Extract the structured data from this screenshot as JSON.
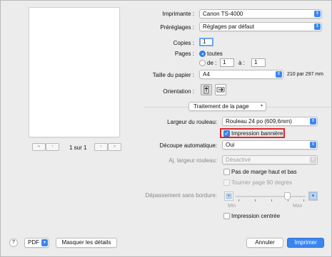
{
  "printer": {
    "label": "Imprimante :",
    "value": "Canon TS-4000"
  },
  "presets": {
    "label": "Préréglages :",
    "value": "Réglages par défaut"
  },
  "copies": {
    "label": "Copies :",
    "value": "1"
  },
  "pages": {
    "label": "Pages :",
    "all_label": "toutes",
    "range_label": "de :",
    "from_value": "1",
    "to_label": "à :",
    "to_value": "1"
  },
  "paper_size": {
    "label": "Taille du papier :",
    "value": "A4",
    "dimensions": "210 par 297 mm"
  },
  "orientation": {
    "label": "Orientation :"
  },
  "section_popup": {
    "value": "Traitement de la page"
  },
  "roll_width": {
    "label": "Largeur du rouleau:",
    "value": "Rouleau 24 po (609,6mm)"
  },
  "banner_print": {
    "label": "Impression bannière",
    "checked": true
  },
  "auto_cut": {
    "label": "Découpe automatique:",
    "value": "Oui"
  },
  "adj_roll_width": {
    "label": "Aj. largeur rouleau:",
    "value": "Désactivé"
  },
  "no_top_bottom_margin": {
    "label": "Pas de marge haut et bas",
    "checked": false
  },
  "rotate_90": {
    "label": "Tourner page 90 degrés",
    "checked": false
  },
  "borderless_overflow": {
    "label": "Dépassement sans bordure:",
    "min_label": "Min",
    "max_label": "Max",
    "level": 0.75
  },
  "center_print": {
    "label": "Impression centrée",
    "checked": false
  },
  "page_nav": {
    "indicator": "1 sur 1",
    "first": "«",
    "prev": "‹",
    "next": "›",
    "last": "»"
  },
  "footer": {
    "help": "?",
    "pdf_label": "PDF",
    "details_label": "Masquer les détails",
    "cancel_label": "Annuler",
    "print_label": "Imprimer"
  },
  "colors": {
    "accent": "#3a86f0",
    "highlight": "#e0262b"
  }
}
